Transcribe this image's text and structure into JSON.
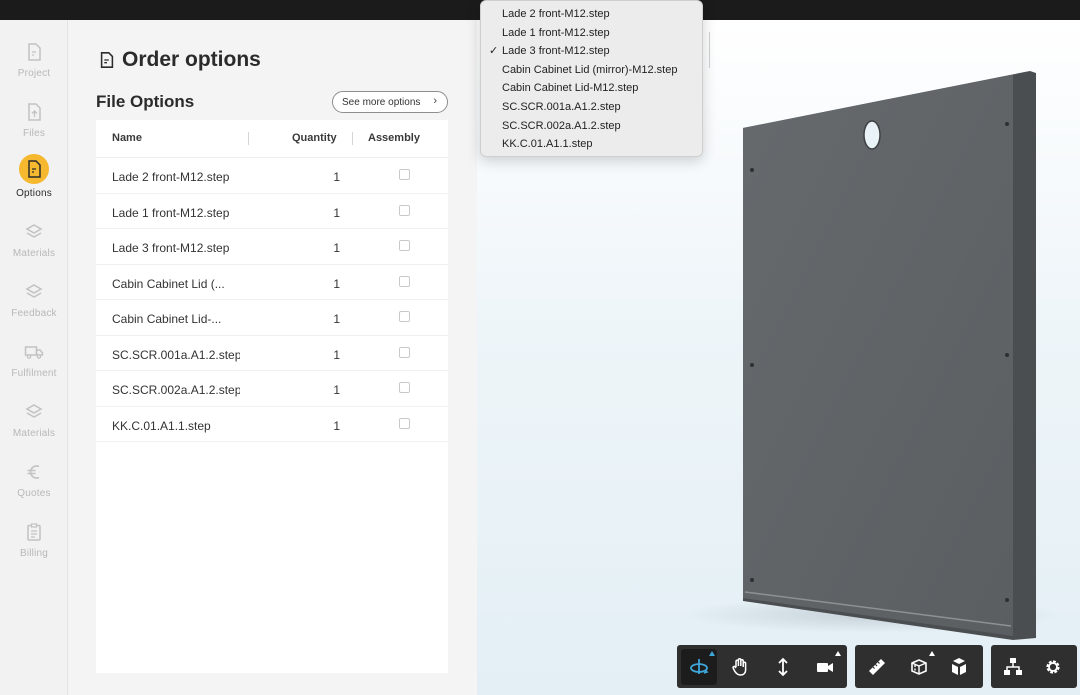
{
  "nav": {
    "items": [
      {
        "label": "Project",
        "icon": "file-icon"
      },
      {
        "label": "Files",
        "icon": "upload-icon"
      },
      {
        "label": "Options",
        "icon": "file-icon",
        "active": true
      },
      {
        "label": "Materials",
        "icon": "layers-icon"
      },
      {
        "label": "Feedback",
        "icon": "layers-icon"
      },
      {
        "label": "Fulfilment",
        "icon": "truck-icon"
      },
      {
        "label": "Materials",
        "icon": "layers-icon"
      },
      {
        "label": "Quotes",
        "icon": "euro-icon"
      },
      {
        "label": "Billing",
        "icon": "clipboard-icon"
      }
    ]
  },
  "panel": {
    "title": "Order options",
    "section_title": "File Options",
    "see_more_label": "See more options",
    "table": {
      "headers": {
        "name": "Name",
        "quantity": "Quantity",
        "assembly": "Assembly"
      },
      "rows": [
        {
          "name": "Lade 2 front-M12.step",
          "quantity": "1",
          "assembly": false
        },
        {
          "name": "Lade 1 front-M12.step",
          "quantity": "1",
          "assembly": false
        },
        {
          "name": "Lade 3 front-M12.step",
          "quantity": "1",
          "assembly": false
        },
        {
          "name": "Cabin Cabinet Lid (...",
          "quantity": "1",
          "assembly": false
        },
        {
          "name": "Cabin Cabinet Lid-...",
          "quantity": "1",
          "assembly": false
        },
        {
          "name": "SC.SCR.001a.A1.2.step",
          "quantity": "1",
          "assembly": false
        },
        {
          "name": "SC.SCR.002a.A1.2.step",
          "quantity": "1",
          "assembly": false
        },
        {
          "name": "KK.C.01.A1.1.step",
          "quantity": "1",
          "assembly": false
        }
      ]
    }
  },
  "dropdown": {
    "selected_index": 2,
    "check_glyph": "✓",
    "options": [
      "Lade 2 front-M12.step",
      "Lade 1 front-M12.step",
      "Lade 3 front-M12.step",
      "Cabin Cabinet Lid (mirror)-M12.step",
      "Cabin Cabinet Lid-M12.step",
      "SC.SCR.001a.A1.2.step",
      "SC.SCR.002a.A1.2.step",
      "KK.C.01.A1.1.step"
    ]
  },
  "toolbar": {
    "groups": [
      {
        "buttons": [
          "orbit-icon",
          "pan-hand-icon",
          "vertical-move-icon",
          "camera-icon"
        ],
        "active": "orbit-icon"
      },
      {
        "buttons": [
          "ruler-icon",
          "section-box-icon",
          "cube-explode-icon"
        ]
      },
      {
        "buttons": [
          "tree-structure-icon",
          "settings-gear-icon"
        ]
      }
    ]
  },
  "colors": {
    "accent": "#f5b82e",
    "toolbar_bg": "#2f2f2f",
    "active_tool": "#3ea7d9",
    "model_panel": "#5f6366"
  }
}
